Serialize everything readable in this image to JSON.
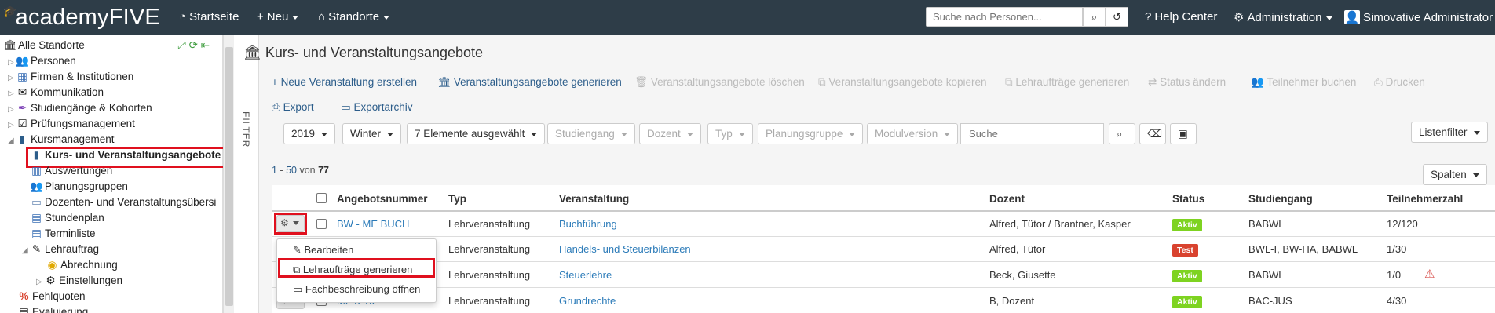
{
  "topbar": {
    "brand": "academyFIVE",
    "nav": [
      {
        "label": "Startseite",
        "icon": "dashboard-icon"
      },
      {
        "label": "Neu",
        "icon": "plus-icon"
      },
      {
        "label": "Standorte",
        "icon": "home-icon"
      }
    ],
    "search_placeholder": "Suche nach Personen...",
    "help": "Help Center",
    "admin": "Administration",
    "user": "Simovative Administrator"
  },
  "tree": {
    "root": "Alle Standorte",
    "items": [
      "Personen",
      "Firmen & Institutionen",
      "Kommunikation",
      "Studiengänge & Kohorten",
      "Prüfungsmanagement",
      "Kursmanagement",
      "Kurs- und Veranstaltungsangebote",
      "Auswertungen",
      "Planungsgruppen",
      "Dozenten- und Veranstaltungsübersi",
      "Stundenplan",
      "Terminliste",
      "Lehrauftrag",
      "Abrechnung",
      "Einstellungen",
      "Fehlquoten",
      "Evaluierung"
    ]
  },
  "filter_label": "FILTER",
  "main": {
    "title": "Kurs- und Veranstaltungsangebote",
    "actions_row1": [
      {
        "label": "Neue Veranstaltung erstellen",
        "enabled": true
      },
      {
        "label": "Veranstaltungsangebote generieren",
        "enabled": true
      },
      {
        "label": "Veranstaltungsangebote löschen",
        "enabled": false
      },
      {
        "label": "Veranstaltungsangebote kopieren",
        "enabled": false
      },
      {
        "label": "Lehraufträge generieren",
        "enabled": false
      },
      {
        "label": "Status ändern",
        "enabled": false
      },
      {
        "label": "Teilnehmer buchen",
        "enabled": false
      },
      {
        "label": "Drucken",
        "enabled": false
      }
    ],
    "actions_row2": [
      {
        "label": "Export",
        "enabled": true
      },
      {
        "label": "Exportarchiv",
        "enabled": true
      }
    ],
    "filters": [
      {
        "label": "2019",
        "active": true
      },
      {
        "label": "Winter",
        "active": true
      },
      {
        "label": "7 Elemente ausgewählt",
        "active": true
      },
      {
        "label": "Studiengang",
        "active": false
      },
      {
        "label": "Dozent",
        "active": false
      },
      {
        "label": "Typ",
        "active": false
      },
      {
        "label": "Planungsgruppe",
        "active": false
      },
      {
        "label": "Modulversion",
        "active": false
      }
    ],
    "search_placeholder": "Suche",
    "list_filter": "Listenfilter",
    "columns_btn": "Spalten",
    "pager": {
      "from": "1",
      "sep": " - ",
      "to": "50",
      "of": " von ",
      "total": "77"
    }
  },
  "table": {
    "headers": [
      "Angebotsnummer",
      "Typ",
      "Veranstaltung",
      "Dozent",
      "Status",
      "Studiengang",
      "Teilnehmerzahl"
    ],
    "rows": [
      {
        "nr": "BW - ME BUCH",
        "typ": "Lehrveranstaltung",
        "veranstaltung": "Buchführung",
        "dozent": "Alfred, Tütor / Brantner, Kasper",
        "status": "Aktiv",
        "studiengang": "BABWL",
        "teilnehmer": "12/120"
      },
      {
        "nr": "",
        "typ": "Lehrveranstaltung",
        "veranstaltung": "Handels- und Steuerbilanzen",
        "dozent": "Alfred, Tütor",
        "status": "Test",
        "studiengang": "BWL-I, BW-HA, BABWL",
        "teilnehmer": "1/30"
      },
      {
        "nr": "",
        "typ": "Lehrveranstaltung",
        "veranstaltung": "Steuerlehre",
        "dozent": "Beck, Giusette",
        "status": "Aktiv",
        "studiengang": "BABWL",
        "teilnehmer": "1/0"
      },
      {
        "nr": "M2-8-19",
        "typ": "Lehrveranstaltung",
        "veranstaltung": "Grundrechte",
        "dozent": "B, Dozent",
        "status": "Aktiv",
        "studiengang": "BAC-JUS",
        "teilnehmer": "4/30"
      }
    ]
  },
  "row_menu": [
    "Bearbeiten",
    "Lehraufträge generieren",
    "Fachbeschreibung öffnen"
  ],
  "colors": {
    "navbar": "#2e3d48",
    "highlight": "#e0101e",
    "aktiv": "#7ed321",
    "test": "#d9432f",
    "link": "#2a7ab8"
  }
}
